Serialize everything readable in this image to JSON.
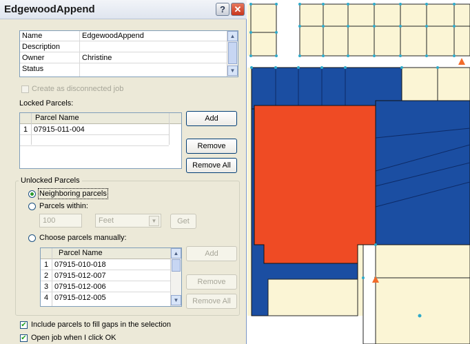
{
  "dialog": {
    "title": "EdgewoodAppend",
    "help_glyph": "?",
    "close_glyph": "✕"
  },
  "properties": [
    {
      "key": "Name",
      "value": "EdgewoodAppend"
    },
    {
      "key": "Description",
      "value": ""
    },
    {
      "key": "Owner",
      "value": "Christine"
    },
    {
      "key": "Status",
      "value": ""
    }
  ],
  "create_disconnected": {
    "label": "Create as disconnected job",
    "checked": false,
    "enabled": false
  },
  "locked": {
    "label": "Locked Parcels:",
    "column": "Parcel Name",
    "rows": [
      {
        "num": "1",
        "parcel": "07915-011-004"
      }
    ],
    "add_label": "Add",
    "remove_label": "Remove",
    "remove_all_label": "Remove All"
  },
  "unlocked": {
    "group_label": "Unlocked Parcels",
    "neighboring_label": "Neighboring parcels",
    "within_label": "Parcels within:",
    "distance_value": "100",
    "units_value": "Feet",
    "get_label": "Get",
    "manual_label": "Choose parcels manually:",
    "column": "Parcel Name",
    "rows": [
      {
        "num": "1",
        "parcel": "07915-010-018"
      },
      {
        "num": "2",
        "parcel": "07915-012-007"
      },
      {
        "num": "3",
        "parcel": "07915-012-006"
      },
      {
        "num": "4",
        "parcel": "07915-012-005"
      }
    ],
    "add_label": "Add",
    "remove_label": "Remove",
    "remove_all_label": "Remove All",
    "selected_option": "Neighboring parcels"
  },
  "include_gaps": {
    "label": "Include parcels to fill gaps in the selection",
    "checked": true
  },
  "open_job": {
    "label": "Open job when I click OK",
    "checked": true
  },
  "colors": {
    "parcel_fill": "#fbf5d5",
    "locked_fill": "#ef4b24",
    "neighbor_fill": "#1b4ea2",
    "road_fill": "#ffffff",
    "vertex": "#2ea9c9",
    "marker": "#f26b2a"
  }
}
